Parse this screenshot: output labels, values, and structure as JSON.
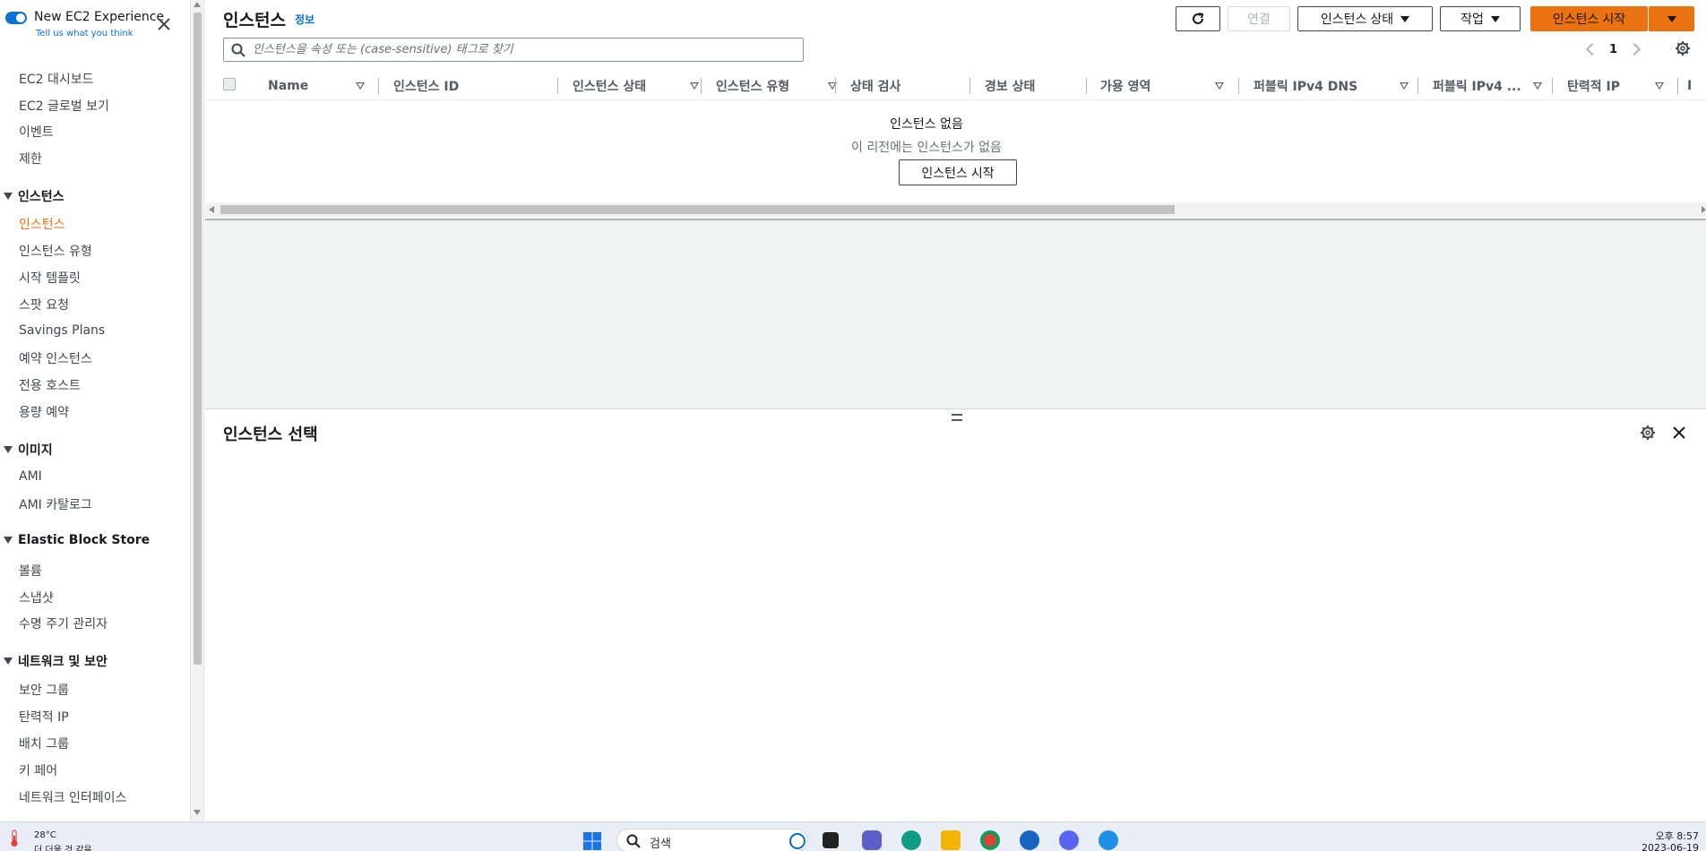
{
  "sidebar": {
    "toggle_label": "New EC2 Experience",
    "toggle_sublink": "Tell us what you think",
    "items_top": [
      "EC2 대시보드",
      "EC2 글로벌 보기",
      "이벤트",
      "제한"
    ],
    "section_instances": "인스턴스",
    "items_instances": [
      "인스턴스",
      "인스턴스 유형",
      "시작 템플릿",
      "스팟 요청",
      "Savings Plans",
      "예약 인스턴스",
      "전용 호스트",
      "용량 예약"
    ],
    "section_images": "이미지",
    "items_images": [
      "AMI",
      "AMI 카탈로그"
    ],
    "section_ebs": "Elastic Block Store",
    "items_ebs": [
      "볼륨",
      "스냅샷",
      "수명 주기 관리자"
    ],
    "section_network": "네트워크 및 보안",
    "items_network": [
      "보안 그룹",
      "탄력적 IP",
      "배치 그룹",
      "키 페어",
      "네트워크 인터페이스"
    ]
  },
  "header": {
    "title": "인스턴스",
    "info": "정보",
    "connect_label": "연결",
    "instance_state_label": "인스턴스 상태",
    "actions_label": "작업",
    "launch_label": "인스턴스 시작"
  },
  "search": {
    "placeholder": "인스턴스을 속성 또는 (case-sensitive) 태그로 찾기",
    "value": ""
  },
  "pagination": {
    "page": "1"
  },
  "table": {
    "columns": [
      "Name",
      "인스턴스 ID",
      "인스턴스 상태",
      "인스턴스 유형",
      "상태 검사",
      "경보 상태",
      "가용 영역",
      "퍼블릭 IPv4 DNS",
      "퍼블릭 IPv4 ...",
      "탄력적 IP",
      "I"
    ]
  },
  "empty_state": {
    "title": "인스턴스 없음",
    "subtitle": "이 리전에는 인스턴스가 없음",
    "button": "인스턴스 시작"
  },
  "bottom_panel": {
    "title": "인스턴스 선택"
  },
  "taskbar": {
    "temp": "28°C",
    "weather": "더 더울 것 같음",
    "search": "검색",
    "time": "오후 8:57",
    "date": "2023-06-19"
  },
  "colors": {
    "accent": "#ec7211",
    "link": "#0972d3",
    "text": "#16191f"
  },
  "icons": [
    "toggle-icon",
    "close-icon",
    "refresh-icon",
    "caret-down-icon",
    "search-icon",
    "chevron-left-icon",
    "chevron-right-icon",
    "gear-icon",
    "sort-icon",
    "drag-handle-icon",
    "windows-start-icon",
    "bing-icon",
    "chrome-icon",
    "edge-icon",
    "folder-icon",
    "discord-icon",
    "docker-icon",
    "teams-icon"
  ]
}
